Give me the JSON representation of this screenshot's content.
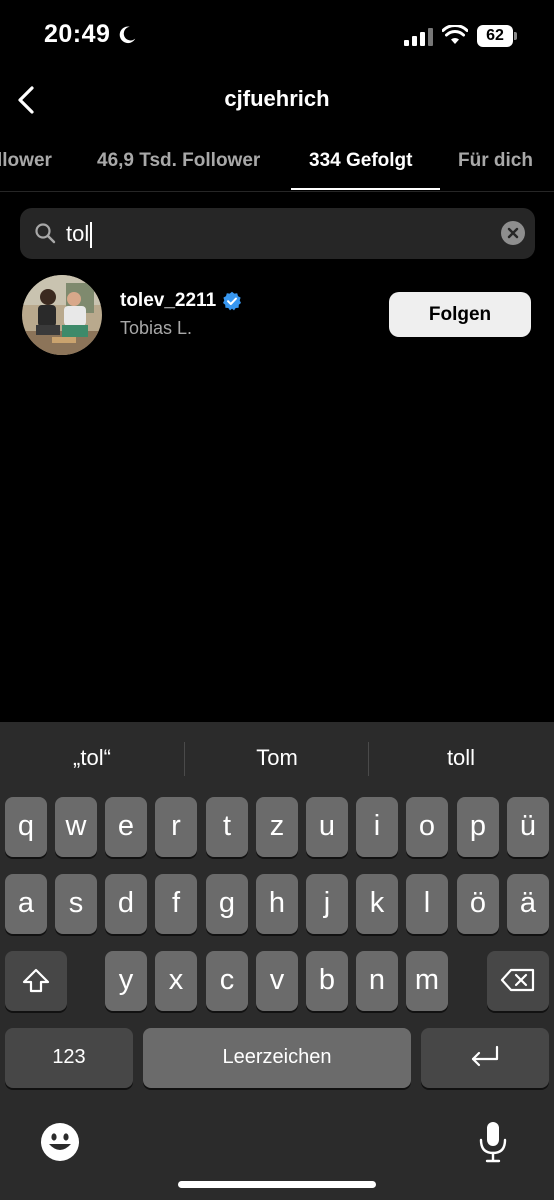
{
  "status_bar": {
    "time": "20:49",
    "battery": "62"
  },
  "header": {
    "title": "cjfuehrich"
  },
  "tabs": [
    {
      "label": "llower"
    },
    {
      "label": "46,9 Tsd. Follower"
    },
    {
      "label": "334 Gefolgt"
    },
    {
      "label": "Für dich"
    }
  ],
  "search": {
    "value": "tol"
  },
  "results": [
    {
      "username": "tolev_2211",
      "full_name": "Tobias L.",
      "button": "Folgen"
    }
  ],
  "keyboard": {
    "suggestions": [
      "„tol“",
      "Tom",
      "toll"
    ],
    "rows": [
      [
        "q",
        "w",
        "e",
        "r",
        "t",
        "z",
        "u",
        "i",
        "o",
        "p",
        "ü"
      ],
      [
        "a",
        "s",
        "d",
        "f",
        "g",
        "h",
        "j",
        "k",
        "l",
        "ö",
        "ä"
      ],
      [
        "y",
        "x",
        "c",
        "v",
        "b",
        "n",
        "m"
      ]
    ],
    "numbers_label": "123",
    "space_label": "Leerzeichen"
  },
  "colors": {
    "background": "#000000",
    "accent_verified": "#3897f0",
    "follow_button": "#efefef"
  }
}
